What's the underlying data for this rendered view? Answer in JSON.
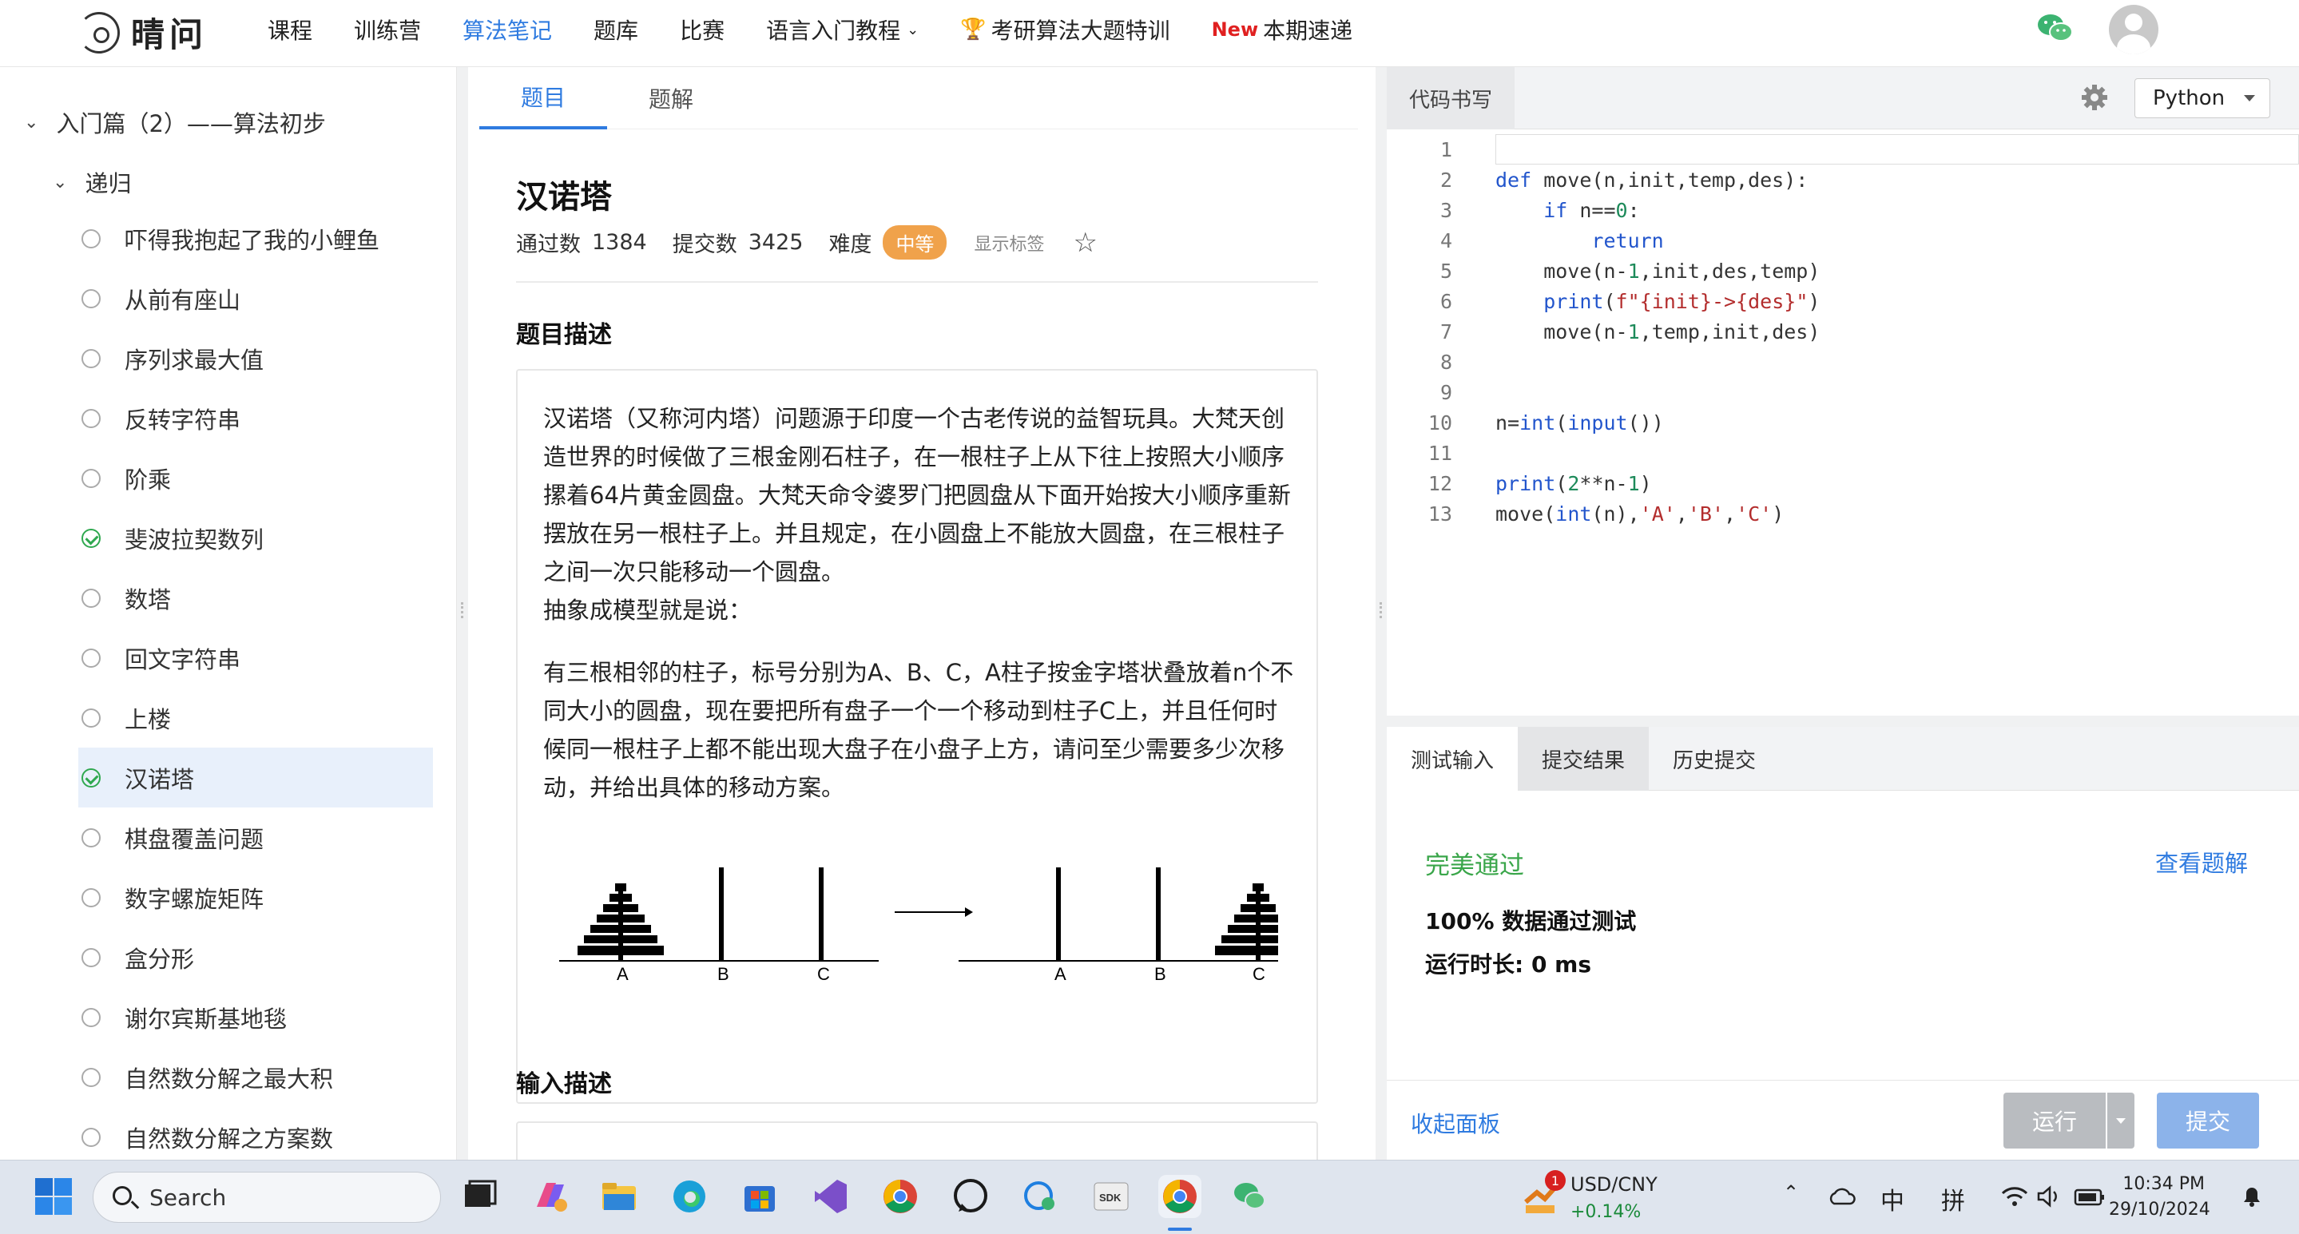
{
  "app": {
    "logo_text": "晴问"
  },
  "nav": {
    "items": [
      {
        "label": "课程"
      },
      {
        "label": "训练营"
      },
      {
        "label": "算法笔记"
      },
      {
        "label": "题库"
      },
      {
        "label": "比赛"
      },
      {
        "label": "语言入门教程"
      },
      {
        "label": "考研算法大题特训"
      },
      {
        "label": "本期速递",
        "badge": "New"
      }
    ],
    "active_index": 2
  },
  "sidebar": {
    "chapter": "入门篇（2）——算法初步",
    "section": "递归",
    "items": [
      {
        "label": "吓得我抱起了我的小鲤鱼",
        "done": false
      },
      {
        "label": "从前有座山",
        "done": false
      },
      {
        "label": "序列求最大值",
        "done": false
      },
      {
        "label": "反转字符串",
        "done": false
      },
      {
        "label": "阶乘",
        "done": false
      },
      {
        "label": "斐波拉契数列",
        "done": true
      },
      {
        "label": "数塔",
        "done": false
      },
      {
        "label": "回文字符串",
        "done": false
      },
      {
        "label": "上楼",
        "done": false
      },
      {
        "label": "汉诺塔",
        "done": true,
        "active": true
      },
      {
        "label": "棋盘覆盖问题",
        "done": false
      },
      {
        "label": "数字螺旋矩阵",
        "done": false
      },
      {
        "label": "盒分形",
        "done": false
      },
      {
        "label": "谢尔宾斯基地毯",
        "done": false
      },
      {
        "label": "自然数分解之最大积",
        "done": false
      },
      {
        "label": "自然数分解之方案数",
        "done": false
      }
    ]
  },
  "problem": {
    "tabs": [
      "题目",
      "题解"
    ],
    "title": "汉诺塔",
    "pass_label": "通过数",
    "pass_count": "1384",
    "submit_label": "提交数",
    "submit_count": "3425",
    "difficulty_label": "难度",
    "difficulty": "中等",
    "show_tags": "显示标签",
    "desc_heading": "题目描述",
    "desc_p1": "汉诺塔（又称河内塔）问题源于印度一个古老传说的益智玩具。大梵天创造世界的时候做了三根金刚石柱子，在一根柱子上从下往上按照大小顺序摞着64片黄金圆盘。大梵天命令婆罗门把圆盘从下面开始按大小顺序重新摆放在另一根柱子上。并且规定，在小圆盘上不能放大圆盘，在三根柱子之间一次只能移动一个圆盘。",
    "desc_p2": "抽象成模型就是说：",
    "desc_p3": "有三根相邻的柱子，标号分别为A、B、C，A柱子按金字塔状叠放着n个不同大小的圆盘，现在要把所有盘子一个一个移动到柱子C上，并且任何时候同一根柱子上都不能出现大盘子在小盘子上方，请问至少需要多少次移动，并给出具体的移动方案。",
    "figure_labels": [
      "A",
      "B",
      "C",
      "A",
      "B",
      "C"
    ],
    "input_heading": "输入描述"
  },
  "editor": {
    "tab": "代码书写",
    "language": "Python",
    "lines": [
      "",
      "def move(n,init,temp,des):",
      "    if n==0:",
      "        return",
      "    move(n-1,init,des,temp)",
      "    print(f\"{init}->{des}\")",
      "    move(n-1,temp,init,des)",
      "",
      "",
      "n=int(input())",
      "",
      "print(2**n-1)",
      "move(int(n),'A','B','C')"
    ],
    "line_numbers": [
      "1",
      "2",
      "3",
      "4",
      "5",
      "6",
      "7",
      "8",
      "9",
      "10",
      "11",
      "12",
      "13"
    ]
  },
  "result": {
    "tabs": [
      "测试输入",
      "提交结果",
      "历史提交"
    ],
    "active_tab": 1,
    "status": "完美通过",
    "view_solution": "查看题解",
    "pass_rate": "100% 数据通过测试",
    "runtime": "运行时长: 0 ms",
    "collapse": "收起面板",
    "run": "运行",
    "submit": "提交"
  },
  "taskbar": {
    "search_placeholder": "Search",
    "stock_badge": "1",
    "stock_label": "USD/CNY",
    "stock_change": "+0.14%",
    "ime_zh": "中",
    "ime_pinyin": "拼",
    "time": "10:34 PM",
    "date": "29/10/2024"
  },
  "colors": {
    "accent": "#2f7be0",
    "success": "#3aa64a",
    "difficulty": "#f0a24b",
    "new_badge": "#e02020"
  }
}
